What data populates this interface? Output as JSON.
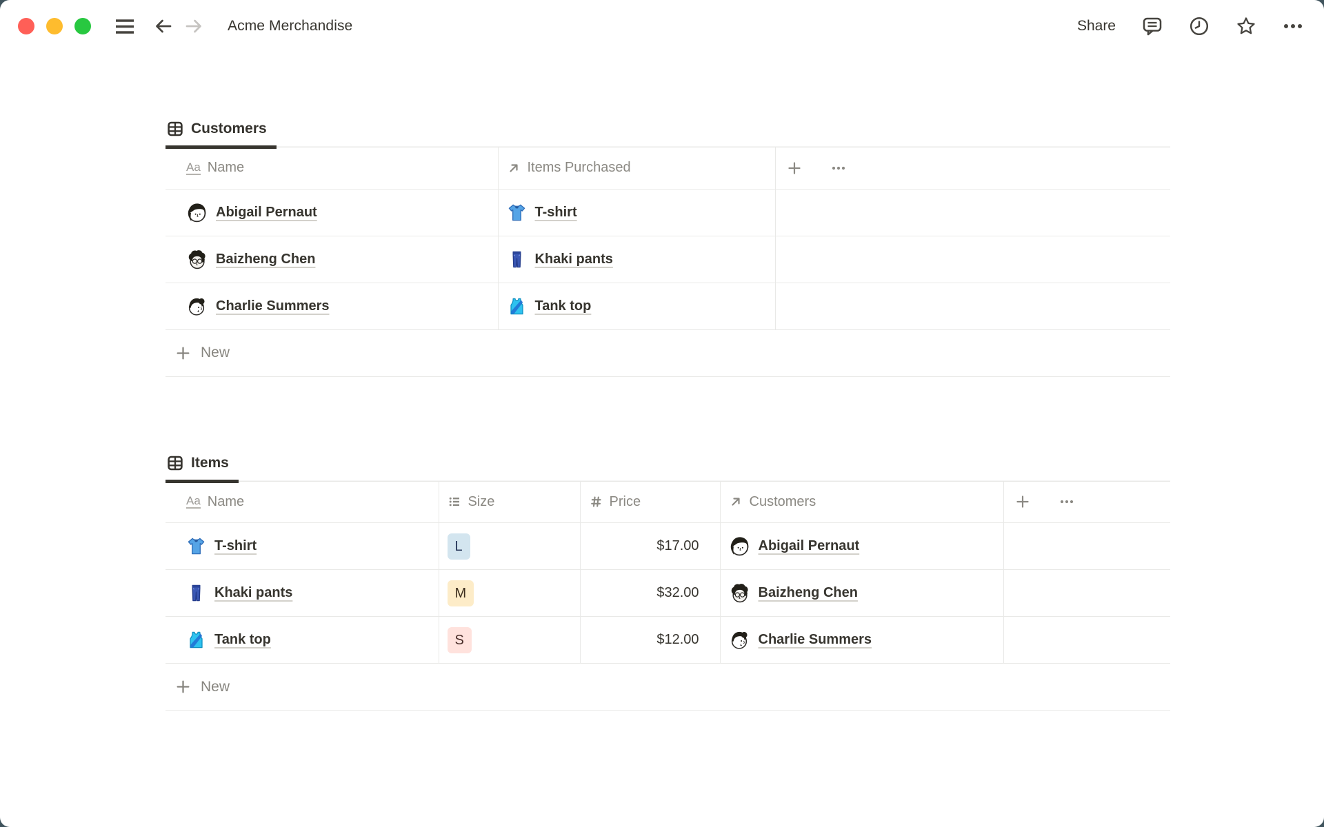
{
  "titlebar": {
    "title": "Acme Merchandise",
    "share_label": "Share"
  },
  "customers_section": {
    "tab_label": "Customers",
    "columns": {
      "name": "Name",
      "items_purchased": "Items Purchased"
    },
    "rows": [
      {
        "name": "Abigail Pernaut",
        "avatar": "avatar-abigail",
        "item": "T-shirt",
        "item_icon": "tshirt-icon"
      },
      {
        "name": "Baizheng Chen",
        "avatar": "avatar-baizheng",
        "item": "Khaki pants",
        "item_icon": "jeans-icon"
      },
      {
        "name": "Charlie Summers",
        "avatar": "avatar-charlie",
        "item": "Tank top",
        "item_icon": "tanktop-icon"
      }
    ],
    "new_label": "New"
  },
  "items_section": {
    "tab_label": "Items",
    "columns": {
      "name": "Name",
      "size": "Size",
      "price": "Price",
      "customers": "Customers"
    },
    "rows": [
      {
        "name": "T-shirt",
        "item_icon": "tshirt-icon",
        "size": "L",
        "size_color": "blue",
        "price": "$17.00",
        "customer": "Abigail Pernaut",
        "customer_avatar": "avatar-abigail"
      },
      {
        "name": "Khaki pants",
        "item_icon": "jeans-icon",
        "size": "M",
        "size_color": "yellow",
        "price": "$32.00",
        "customer": "Baizheng Chen",
        "customer_avatar": "avatar-baizheng"
      },
      {
        "name": "Tank top",
        "item_icon": "tanktop-icon",
        "size": "S",
        "size_color": "pink",
        "price": "$12.00",
        "customer": "Charlie Summers",
        "customer_avatar": "avatar-charlie"
      }
    ],
    "new_label": "New"
  },
  "colors": {
    "desktop_background": "#40545d",
    "text_primary": "#37352f",
    "text_secondary": "#87857f",
    "table_border": "#e9e9e7",
    "tab_underline": "#37352f",
    "badge_blue_bg": "#d3e5ef",
    "badge_yellow_bg": "#fdecc8",
    "badge_pink_bg": "#ffe2dd",
    "traffic_red": "#ff5f57",
    "traffic_yellow": "#febc2e",
    "traffic_green": "#28c840"
  }
}
